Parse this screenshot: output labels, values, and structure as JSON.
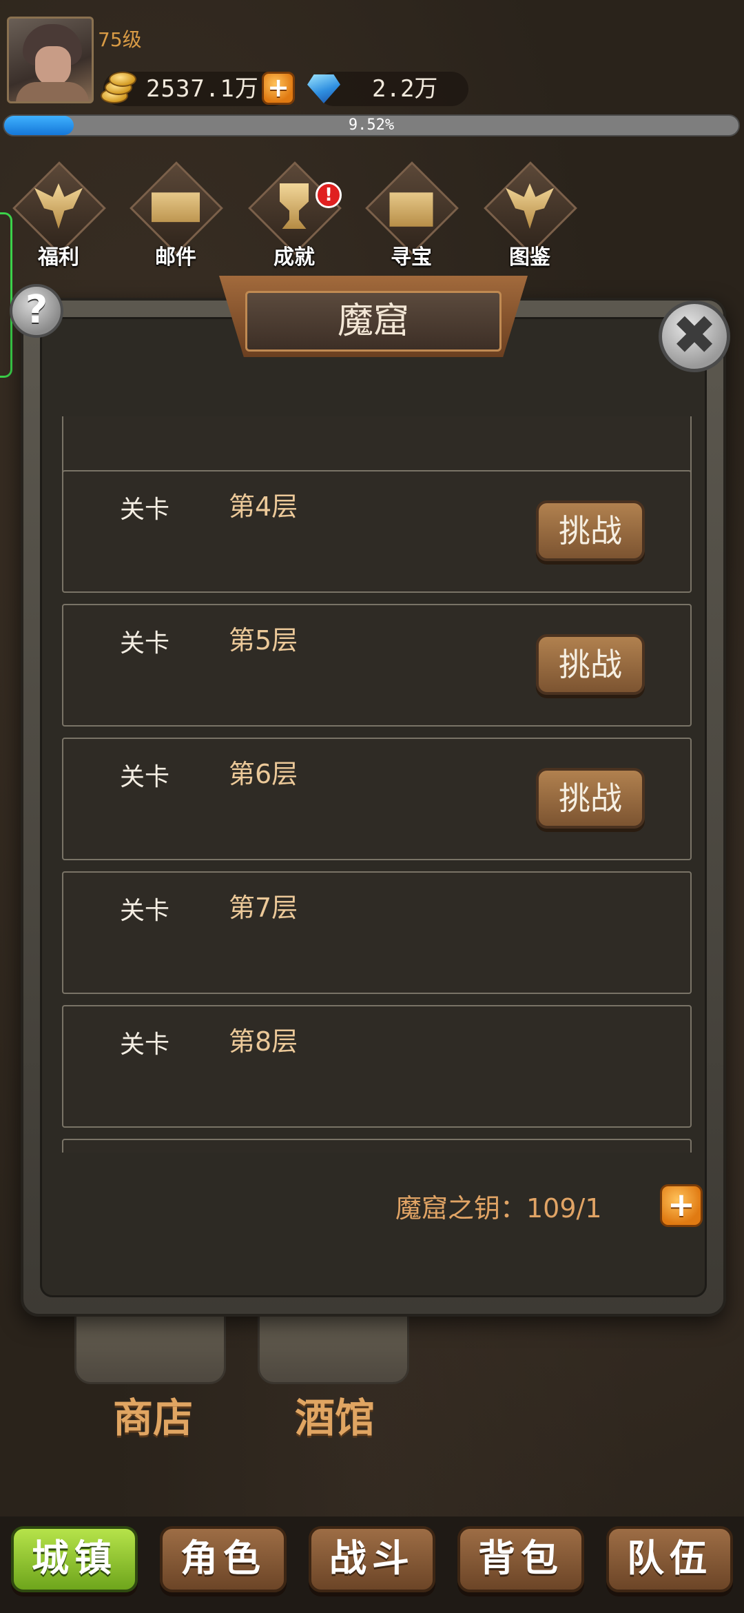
{
  "player": {
    "level": "75级",
    "gold": "2537.1万",
    "gems": "2.2万",
    "exp_percent_text": "9.52%",
    "exp_fraction": 0.0952
  },
  "features": [
    {
      "label": "福利",
      "icon": "wings-crest-icon"
    },
    {
      "label": "邮件",
      "icon": "mail-icon"
    },
    {
      "label": "成就",
      "icon": "trophy-icon",
      "alert": "!"
    },
    {
      "label": "寻宝",
      "icon": "treasure-chest-icon"
    },
    {
      "label": "图鉴",
      "icon": "crest-icon"
    }
  ],
  "modal": {
    "title": "魔窟",
    "close": "✖",
    "help": "?",
    "levels": [
      {
        "name": "关卡",
        "floor": "第4层",
        "button": "挑战"
      },
      {
        "name": "关卡",
        "floor": "第5层",
        "button": "挑战"
      },
      {
        "name": "关卡",
        "floor": "第6层",
        "button": "挑战"
      },
      {
        "name": "关卡",
        "floor": "第7层",
        "button": ""
      },
      {
        "name": "关卡",
        "floor": "第8层",
        "button": ""
      }
    ],
    "key_label": "魔窟之钥：109/1",
    "plus": "+"
  },
  "buildings": [
    {
      "label": "商店"
    },
    {
      "label": "酒馆"
    }
  ],
  "nav": [
    {
      "label": "城镇",
      "active": true
    },
    {
      "label": "角色"
    },
    {
      "label": "战斗"
    },
    {
      "label": "背包"
    },
    {
      "label": "队伍"
    }
  ],
  "colors": {
    "accent_gold": "#d99b45",
    "exp_blue": "#1577d8",
    "active_nav": "#8cc62a",
    "button_brown": "#9d6d45"
  }
}
